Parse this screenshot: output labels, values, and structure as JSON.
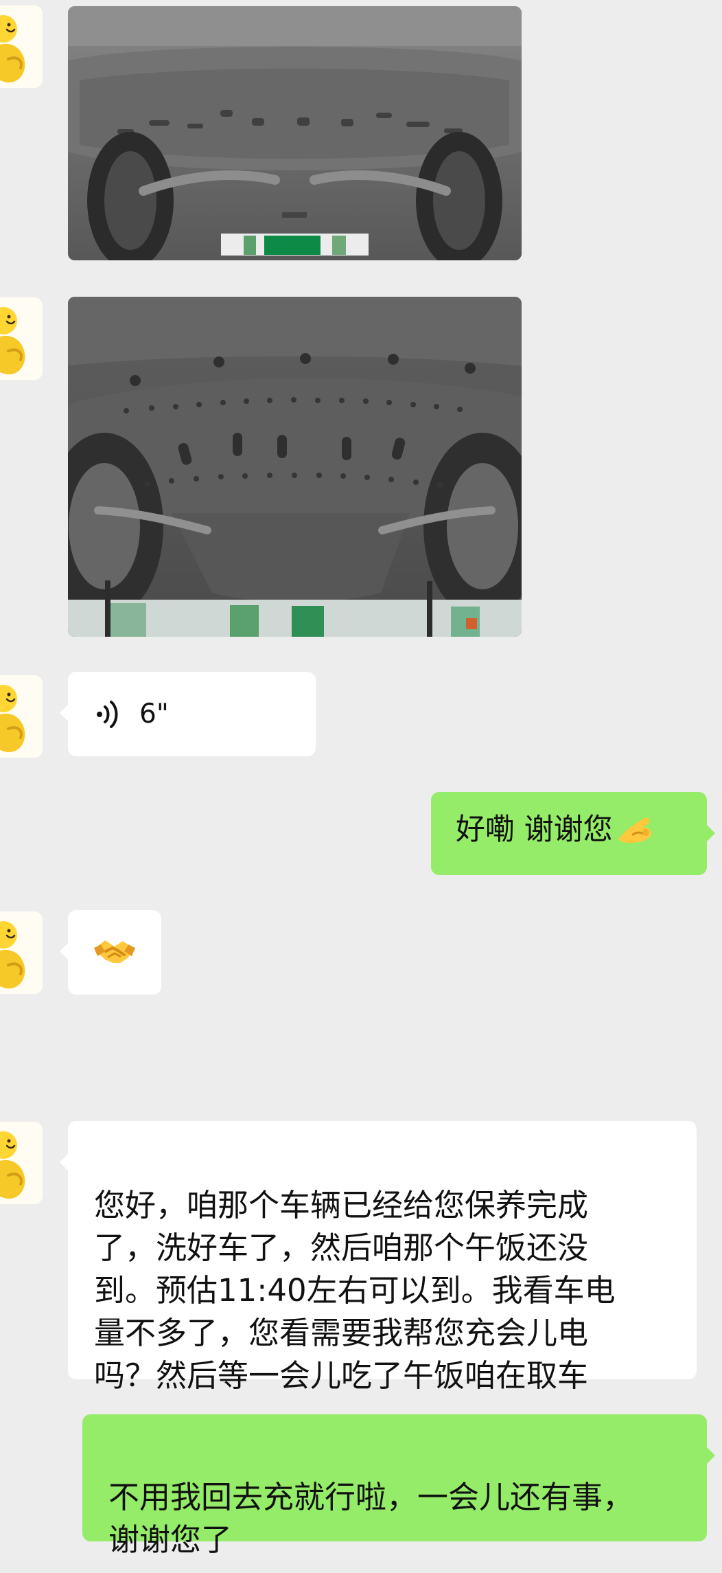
{
  "conversation": {
    "incoming_voice_duration": "6\"",
    "outgoing_reply_1": "好嘞 谢谢您",
    "incoming_long_message": "您好，咱那个车辆已经给您保养完成\n了，洗好车了，然后咱那个午饭还没\n到。预估11:40左右可以到。我看车电\n量不多了，您看需要我帮您充会儿电\n吗？然后等一会儿吃了午饭咱在取车",
    "outgoing_reply_2": "不用我回去充就行啦，一会儿还有事，\n谢谢您了"
  },
  "icons": {
    "avatar": "avatar-icon",
    "voice": "voice-message-icon",
    "ok_hand": "ok-hand-emoji",
    "handshake": "handshake-emoji"
  },
  "colors": {
    "background": "#ededed",
    "incoming_bubble": "#ffffff",
    "outgoing_bubble": "#95ec69",
    "text": "#111111"
  }
}
